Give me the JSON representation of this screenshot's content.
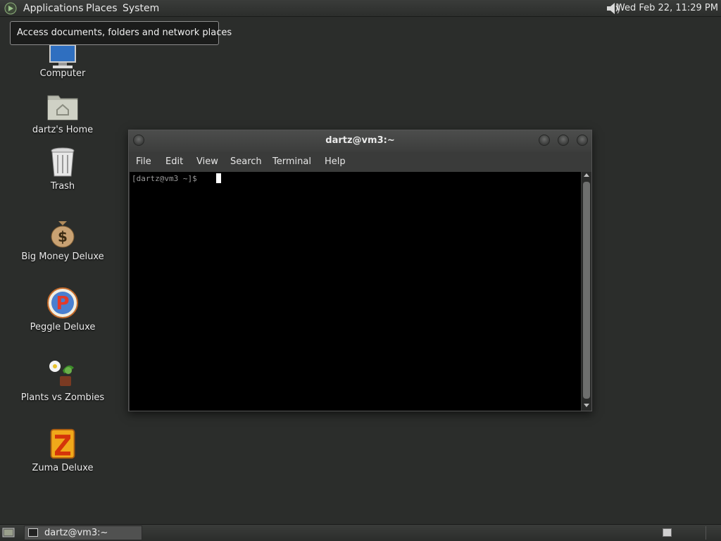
{
  "top_panel": {
    "menus": {
      "applications": "Applications",
      "places": "Places",
      "system": "System"
    },
    "clock": "Wed Feb 22, 11:29 PM",
    "icons": {
      "logo": "gnome-foot-icon",
      "volume": "speaker-volume-icon"
    }
  },
  "tooltip": {
    "text": "Access documents, folders and network places"
  },
  "desktop_icons": [
    {
      "label": "Computer",
      "icon": "computer-icon"
    },
    {
      "label": "dartz's Home",
      "icon": "home-folder-icon"
    },
    {
      "label": "Trash",
      "icon": "trash-icon"
    },
    {
      "label": "Big Money Deluxe",
      "icon": "money-bag-icon"
    },
    {
      "label": "Peggle Deluxe",
      "icon": "peggle-icon"
    },
    {
      "label": "Plants vs Zombies",
      "icon": "plants-icon"
    },
    {
      "label": "Zuma Deluxe",
      "icon": "zuma-icon"
    }
  ],
  "terminal": {
    "title": "dartz@vm3:~",
    "menu": [
      "File",
      "Edit",
      "View",
      "Search",
      "Terminal",
      "Help"
    ],
    "prompt": "[dartz@vm3 ~]$ "
  },
  "bottom_panel": {
    "task_label": "dartz@vm3:~",
    "icons": {
      "show_desktop": "show-desktop-icon",
      "task": "terminal-icon",
      "workspace": "workspace-switcher-icon"
    }
  },
  "colors": {
    "desktop_bg": "#2b2d2b",
    "panel_bg": "#333533",
    "terminal_bg": "#000000"
  }
}
